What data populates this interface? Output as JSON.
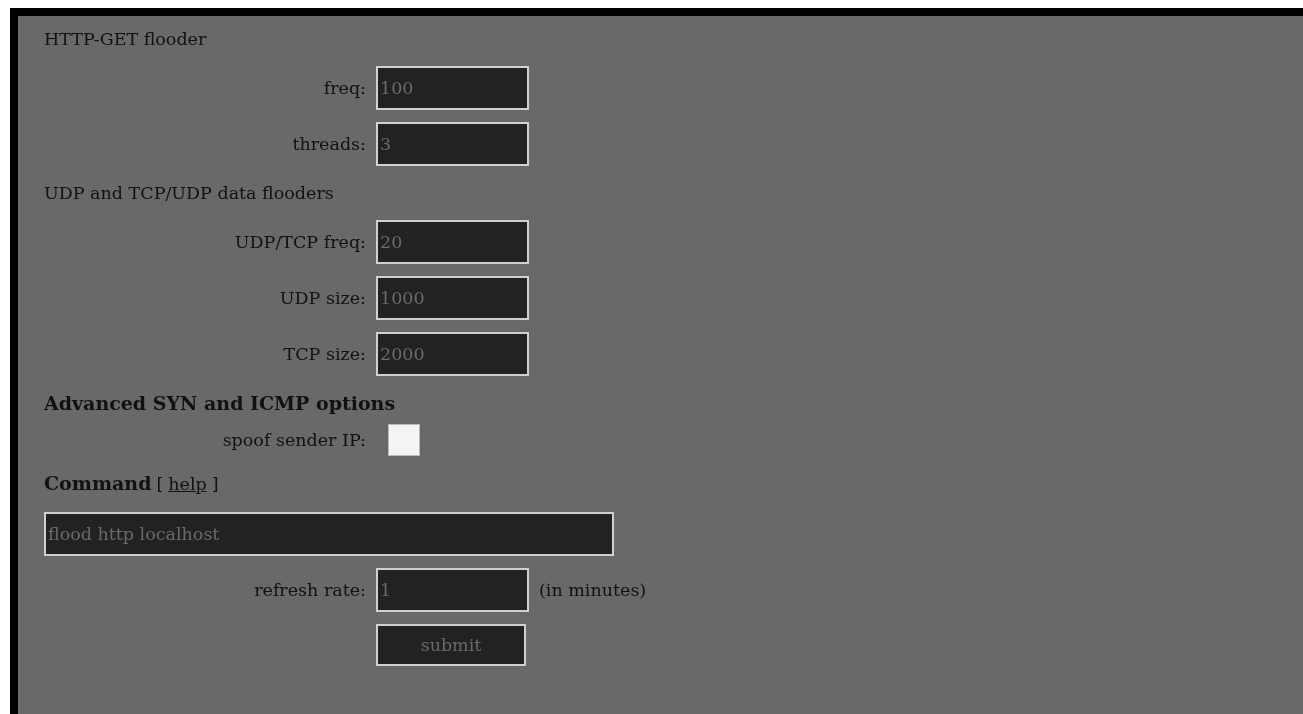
{
  "form": {
    "items": [
      {
        "kind": "heading",
        "text": "HTTP-GET flooder",
        "bold": false
      },
      {
        "kind": "field",
        "label": "freq:",
        "value": "100"
      },
      {
        "kind": "field",
        "label": "threads:",
        "value": "3"
      },
      {
        "kind": "heading",
        "text": "UDP and TCP/UDP data flooders",
        "bold": false
      },
      {
        "kind": "field",
        "label": "UDP/TCP freq:",
        "value": "20"
      },
      {
        "kind": "field",
        "label": "UDP size:",
        "value": "1000"
      },
      {
        "kind": "field",
        "label": "TCP size:",
        "value": "2000"
      },
      {
        "kind": "heading",
        "text": "Advanced SYN and ICMP options",
        "bold": true
      },
      {
        "kind": "checkbox",
        "label": "spoof sender IP:",
        "checked": false
      },
      {
        "kind": "command_heading",
        "text": "Command",
        "open_bracket": "[",
        "link": "help",
        "close_bracket": "]"
      },
      {
        "kind": "command_field",
        "value": "flood http localhost"
      },
      {
        "kind": "field",
        "label": "refresh rate:",
        "value": "1",
        "unit": "(in minutes)"
      },
      {
        "kind": "button",
        "label": "submit"
      }
    ]
  }
}
